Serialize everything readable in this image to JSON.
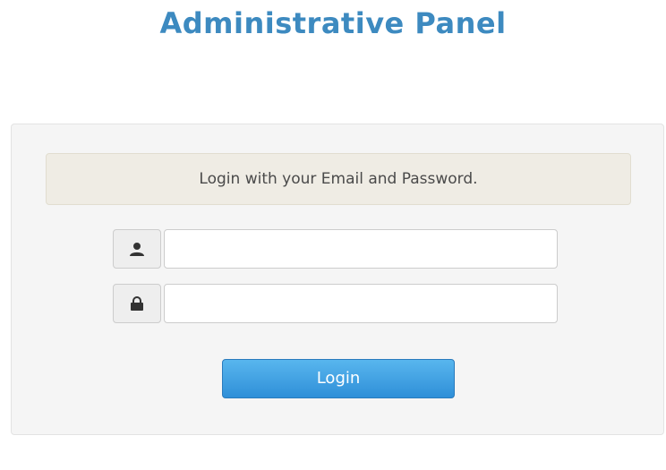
{
  "header": {
    "title": "Administrative Panel"
  },
  "login_panel": {
    "message": "Login with your Email and Password.",
    "email_field": {
      "value": "",
      "placeholder": "",
      "icon": "user-icon"
    },
    "password_field": {
      "value": "",
      "placeholder": "",
      "icon": "lock-icon"
    },
    "login_button_label": "Login"
  },
  "colors": {
    "title": "#3d8ac0",
    "panel_background": "#f5f5f5",
    "alert_background": "#efece4",
    "button_top": "#58b6ee",
    "button_bottom": "#2f8fd8"
  }
}
